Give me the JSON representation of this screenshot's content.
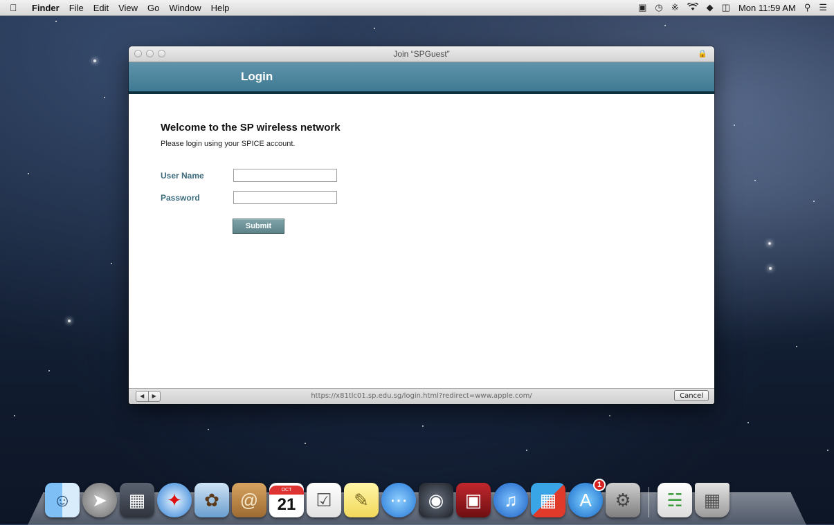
{
  "menubar": {
    "app_name": "Finder",
    "items": [
      "File",
      "Edit",
      "View",
      "Go",
      "Window",
      "Help"
    ],
    "clock": "Mon 11:59 AM"
  },
  "window": {
    "title": "Join “SPGuest”",
    "header_title": "Login",
    "welcome": "Welcome to the SP wireless network",
    "instructions": "Please login using your SPICE account.",
    "username_label": "User Name",
    "password_label": "Password",
    "username_value": "",
    "password_value": "",
    "submit_label": "Submit",
    "url": "https://x81tlc01.sp.edu.sg/login.html?redirect=www.apple.com/",
    "cancel_label": "Cancel"
  },
  "dock": {
    "calendar_month": "OCT",
    "calendar_day": "21",
    "app_store_badge": "1",
    "apps": [
      "finder-icon",
      "launchpad-icon",
      "dashboard-icon",
      "safari-icon",
      "mail-icon",
      "contacts-icon",
      "calendar-icon",
      "reminders-icon",
      "notes-icon",
      "messages-icon",
      "facetime-icon",
      "photo-booth-icon",
      "itunes-icon",
      "parallels-icon",
      "app-store-icon",
      "system-preferences-icon",
      "preview-icon",
      "trash-icon"
    ]
  }
}
